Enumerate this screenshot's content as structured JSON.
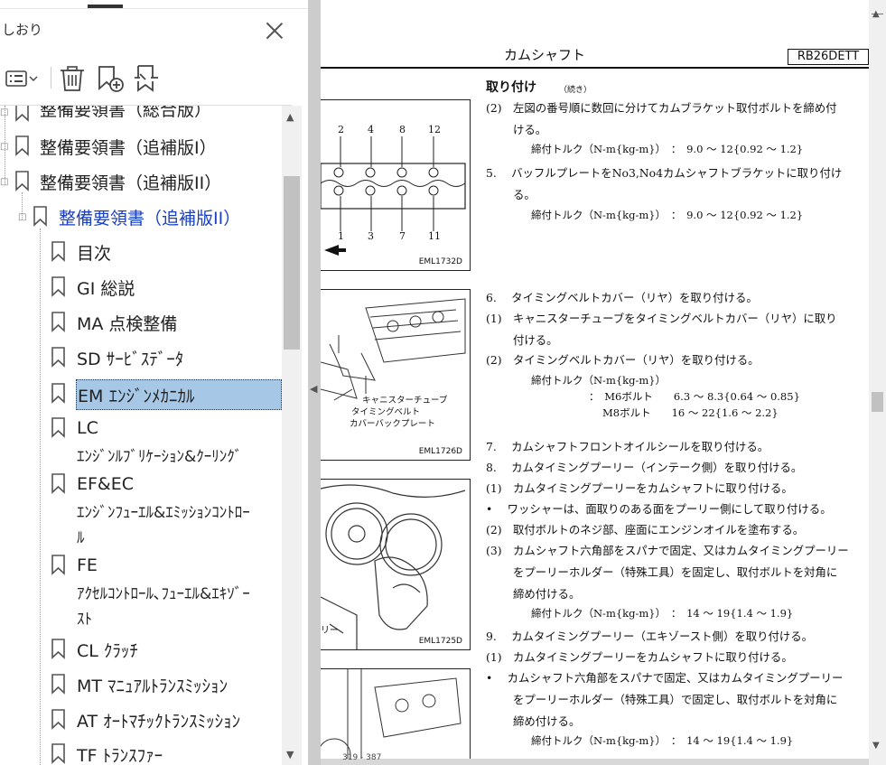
{
  "panel": {
    "title": "しおり",
    "toolbar": {
      "options_icon": "list-options-icon",
      "delete_icon": "trash-icon",
      "add_icon": "bookmark-add-icon",
      "find_icon": "bookmark-find-icon"
    },
    "bookmarks": [
      {
        "label": "整備要領書（総合版）",
        "level": 0,
        "toggle": "□"
      },
      {
        "label": "整備要領書（追補版I）",
        "level": 0,
        "toggle": "□"
      },
      {
        "label": "整備要領書（追補版II）",
        "level": 0,
        "toggle": "□"
      },
      {
        "label": "整備要領書（追補版II）",
        "level": 1,
        "toggle": "□"
      },
      {
        "label": "目次",
        "level": 2
      },
      {
        "label": "GI 総説",
        "level": 2
      },
      {
        "label": "MA 点検整備",
        "level": 2
      },
      {
        "label": "SD ｻｰﾋﾞｽﾃﾞｰﾀ",
        "level": 2
      },
      {
        "label": "EM ｴﾝｼﾞﾝﾒｶﾆｶﾙ",
        "level": 2
      },
      {
        "label": "LC",
        "line2": "ｴﾝｼﾞﾝﾙﾌﾞﾘｹｰｼｮﾝ&ｸｰﾘﾝｸﾞ",
        "level": 2
      },
      {
        "label": "EF&EC",
        "line2": "ｴﾝｼﾞﾝﾌｭｰｴﾙ&ｴﾐｯｼｮﾝｺﾝﾄﾛｰ",
        "line3": "ﾙ",
        "level": 2
      },
      {
        "label": "FE",
        "line2": "ｱｸｾﾙｺﾝﾄﾛｰﾙ､ﾌｭｰｴﾙ&ｴｷｿﾞｰ",
        "line3": "ｽﾄ",
        "level": 2
      },
      {
        "label": "CL ｸﾗｯﾁ",
        "level": 2
      },
      {
        "label": "MT ﾏﾆｭｱﾙﾄﾗﾝｽﾐｯｼｮﾝ",
        "level": 2
      },
      {
        "label": "AT ｵｰﾄﾏﾁｯｸﾄﾗﾝｽﾐｯｼｮﾝ",
        "level": 2
      },
      {
        "label": "TF ﾄﾗﾝｽﾌｧｰ",
        "level": 2
      }
    ],
    "selected_index": 8
  },
  "document": {
    "page_title": "カムシャフト",
    "model": "RB26DETT",
    "section": "取り付け",
    "section_note": "（続き）",
    "figures": [
      {
        "code": "EML1732D",
        "numbers_top": [
          "2",
          "4",
          "8",
          "12"
        ],
        "numbers_bottom": [
          "1",
          "3",
          "7",
          "11"
        ]
      },
      {
        "code": "EML1726D",
        "callouts": [
          "キャニスターチューブ",
          "タイミングベルト",
          "カバーバックプレート"
        ]
      },
      {
        "code": "EML1725D",
        "partial": "リー"
      },
      {
        "code": ""
      }
    ],
    "lines": [
      "(2)　左図の番号順に数回に分けてカムブラケット取付ボルトを締め付",
      "ける。",
      "締付トルク（N-m{kg-m}）　：　9.0 ～ 12{0.92 ～ 1.2}",
      "5.　 バッフルプレートをNo3,No4カムシャフトブラケットに取り付け",
      "る。",
      "締付トルク（N-m{kg-m}）　：　9.0 ～ 12{0.92 ～ 1.2}",
      "6.　 タイミングベルトカバー（リヤ）を取り付ける。",
      "(1)　キャニスターチューブをタイミングベルトカバー（リヤ）に取り",
      "付ける。",
      "(2)　タイミングベルトカバー（リヤ）を取り付ける。",
      "締付トルク（N-m{kg-m}）",
      "：　M6ボルト　　6.3 ～ 8.3{0.64 ～ 0.85}",
      "M8ボルト　　16 ～ 22{1.6 ～ 2.2}",
      "7.　 カムシャフトフロントオイルシールを取り付ける。",
      "8.　 カムタイミングプーリー（インテーク側）を取り付ける。",
      "(1)　カムタイミングプーリーをカムシャフトに取り付ける。",
      "•　 ワッシャーは、面取りのある面をプーリー側にして取り付ける。",
      "(2)　取付ボルトのネジ部、座面にエンジンオイルを塗布する。",
      "(3)　カムシャフト六角部をスパナで固定、又はカムタイミングプーリー",
      "をプーリーホルダー（特殊工具）を固定し、取付ボルトを対角に",
      "締め付ける。",
      "締付トルク（N-m{kg-m}）　：　14 ～ 19{1.4 ～ 1.9}",
      "9.　 カムタイミングプーリー（エキゾースト側）を取り付ける。",
      "(1)　カムタイミングプーリーをカムシャフトに取り付ける。",
      "•　 カムシャフト六角部をスパナで固定、又はカムタイミングプーリー",
      "をプーリーホルダー（特殊工具）で固定し、取付ボルトを対角に",
      "締め付ける。",
      "締付トルク（N-m{kg-m}）　：　14 ～ 19{1.4 ～ 1.9}"
    ],
    "page_indicator": "319 - 387"
  }
}
